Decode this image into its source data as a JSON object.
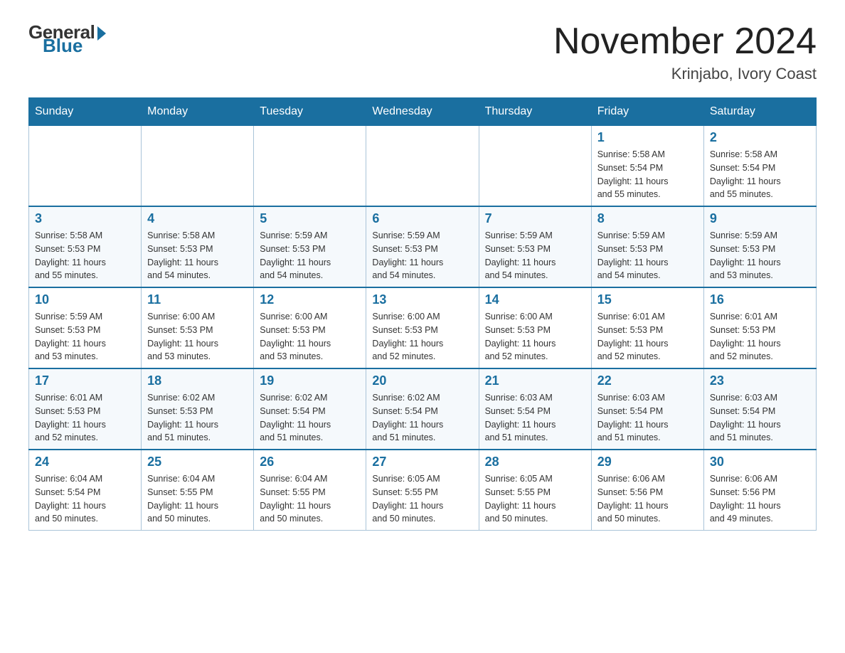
{
  "logo": {
    "general": "General",
    "blue": "Blue"
  },
  "title": {
    "month_year": "November 2024",
    "location": "Krinjabo, Ivory Coast"
  },
  "weekdays": [
    "Sunday",
    "Monday",
    "Tuesday",
    "Wednesday",
    "Thursday",
    "Friday",
    "Saturday"
  ],
  "weeks": [
    [
      {
        "day": "",
        "info": ""
      },
      {
        "day": "",
        "info": ""
      },
      {
        "day": "",
        "info": ""
      },
      {
        "day": "",
        "info": ""
      },
      {
        "day": "",
        "info": ""
      },
      {
        "day": "1",
        "info": "Sunrise: 5:58 AM\nSunset: 5:54 PM\nDaylight: 11 hours\nand 55 minutes."
      },
      {
        "day": "2",
        "info": "Sunrise: 5:58 AM\nSunset: 5:54 PM\nDaylight: 11 hours\nand 55 minutes."
      }
    ],
    [
      {
        "day": "3",
        "info": "Sunrise: 5:58 AM\nSunset: 5:53 PM\nDaylight: 11 hours\nand 55 minutes."
      },
      {
        "day": "4",
        "info": "Sunrise: 5:58 AM\nSunset: 5:53 PM\nDaylight: 11 hours\nand 54 minutes."
      },
      {
        "day": "5",
        "info": "Sunrise: 5:59 AM\nSunset: 5:53 PM\nDaylight: 11 hours\nand 54 minutes."
      },
      {
        "day": "6",
        "info": "Sunrise: 5:59 AM\nSunset: 5:53 PM\nDaylight: 11 hours\nand 54 minutes."
      },
      {
        "day": "7",
        "info": "Sunrise: 5:59 AM\nSunset: 5:53 PM\nDaylight: 11 hours\nand 54 minutes."
      },
      {
        "day": "8",
        "info": "Sunrise: 5:59 AM\nSunset: 5:53 PM\nDaylight: 11 hours\nand 54 minutes."
      },
      {
        "day": "9",
        "info": "Sunrise: 5:59 AM\nSunset: 5:53 PM\nDaylight: 11 hours\nand 53 minutes."
      }
    ],
    [
      {
        "day": "10",
        "info": "Sunrise: 5:59 AM\nSunset: 5:53 PM\nDaylight: 11 hours\nand 53 minutes."
      },
      {
        "day": "11",
        "info": "Sunrise: 6:00 AM\nSunset: 5:53 PM\nDaylight: 11 hours\nand 53 minutes."
      },
      {
        "day": "12",
        "info": "Sunrise: 6:00 AM\nSunset: 5:53 PM\nDaylight: 11 hours\nand 53 minutes."
      },
      {
        "day": "13",
        "info": "Sunrise: 6:00 AM\nSunset: 5:53 PM\nDaylight: 11 hours\nand 52 minutes."
      },
      {
        "day": "14",
        "info": "Sunrise: 6:00 AM\nSunset: 5:53 PM\nDaylight: 11 hours\nand 52 minutes."
      },
      {
        "day": "15",
        "info": "Sunrise: 6:01 AM\nSunset: 5:53 PM\nDaylight: 11 hours\nand 52 minutes."
      },
      {
        "day": "16",
        "info": "Sunrise: 6:01 AM\nSunset: 5:53 PM\nDaylight: 11 hours\nand 52 minutes."
      }
    ],
    [
      {
        "day": "17",
        "info": "Sunrise: 6:01 AM\nSunset: 5:53 PM\nDaylight: 11 hours\nand 52 minutes."
      },
      {
        "day": "18",
        "info": "Sunrise: 6:02 AM\nSunset: 5:53 PM\nDaylight: 11 hours\nand 51 minutes."
      },
      {
        "day": "19",
        "info": "Sunrise: 6:02 AM\nSunset: 5:54 PM\nDaylight: 11 hours\nand 51 minutes."
      },
      {
        "day": "20",
        "info": "Sunrise: 6:02 AM\nSunset: 5:54 PM\nDaylight: 11 hours\nand 51 minutes."
      },
      {
        "day": "21",
        "info": "Sunrise: 6:03 AM\nSunset: 5:54 PM\nDaylight: 11 hours\nand 51 minutes."
      },
      {
        "day": "22",
        "info": "Sunrise: 6:03 AM\nSunset: 5:54 PM\nDaylight: 11 hours\nand 51 minutes."
      },
      {
        "day": "23",
        "info": "Sunrise: 6:03 AM\nSunset: 5:54 PM\nDaylight: 11 hours\nand 51 minutes."
      }
    ],
    [
      {
        "day": "24",
        "info": "Sunrise: 6:04 AM\nSunset: 5:54 PM\nDaylight: 11 hours\nand 50 minutes."
      },
      {
        "day": "25",
        "info": "Sunrise: 6:04 AM\nSunset: 5:55 PM\nDaylight: 11 hours\nand 50 minutes."
      },
      {
        "day": "26",
        "info": "Sunrise: 6:04 AM\nSunset: 5:55 PM\nDaylight: 11 hours\nand 50 minutes."
      },
      {
        "day": "27",
        "info": "Sunrise: 6:05 AM\nSunset: 5:55 PM\nDaylight: 11 hours\nand 50 minutes."
      },
      {
        "day": "28",
        "info": "Sunrise: 6:05 AM\nSunset: 5:55 PM\nDaylight: 11 hours\nand 50 minutes."
      },
      {
        "day": "29",
        "info": "Sunrise: 6:06 AM\nSunset: 5:56 PM\nDaylight: 11 hours\nand 50 minutes."
      },
      {
        "day": "30",
        "info": "Sunrise: 6:06 AM\nSunset: 5:56 PM\nDaylight: 11 hours\nand 49 minutes."
      }
    ]
  ]
}
